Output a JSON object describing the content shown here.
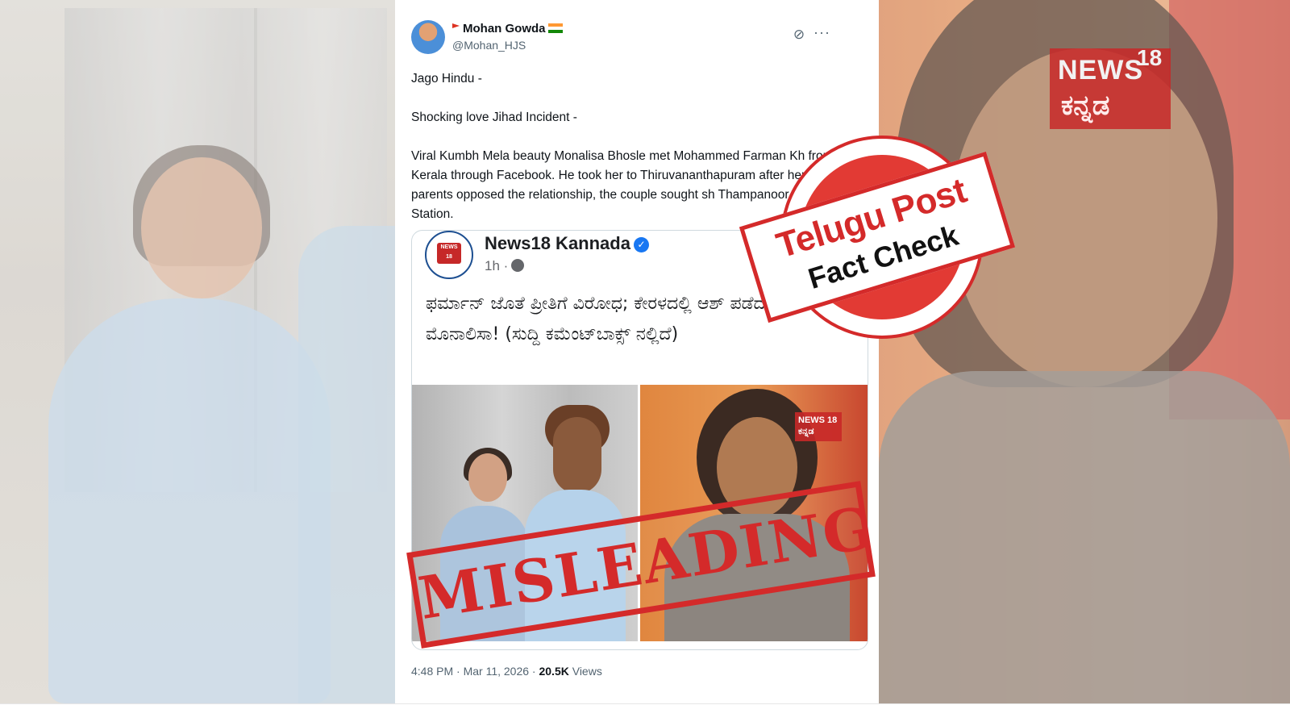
{
  "tweet": {
    "author_name": "Mohan Gowda",
    "author_handle": "@Mohan_HJS",
    "paragraphs": [
      "Jago Hindu -",
      "Shocking love Jihad Incident -",
      "Viral Kumbh Mela beauty Monalisa Bhosle met Mohammed Farman Kh from Kerala through Facebook. He took her to Thiruvananthapuram after her parents opposed the relationship, the couple sought sh Thampanoor Police Station."
    ],
    "timestamp": "4:48 PM · Mar 11, 2026 · ",
    "views_count": "20.5K",
    "views_label": "Views",
    "more_icon": "···"
  },
  "quote": {
    "page_name": "News18 Kannada",
    "time": "1h ·",
    "logo_text": "NEWS 18",
    "headline": "ಫರ್ಮಾನ್ ಜೊತೆ ಪ್ರೀತಿಗೆ ವಿರೋಧ; ಕೇರಳದಲ್ಲಿ ಆಶ್ ಪಡೆದ ಕುಂಭಮೇಳದ ಮೊನಾಲಿಸಾ! (ಸುದ್ದಿ ಕಮೆಂಟ್‌ಬಾಕ್ಸ್ ನಲ್ಲಿದೆ)",
    "image_logo": "NEWS 18 ಕನ್ನಡ"
  },
  "overlays": {
    "verdict_stamp": "MISLEADING",
    "brand_line1": "Telugu Post",
    "brand_line2": "Fact Check"
  },
  "background_logo": {
    "line1": "NEWS",
    "line2": "18",
    "line3": "ಕನ್ನಡ"
  },
  "colors": {
    "stamp_red": "#d42a2a",
    "verified_blue": "#1877f2",
    "text_primary": "#0f1419",
    "text_secondary": "#536471"
  }
}
